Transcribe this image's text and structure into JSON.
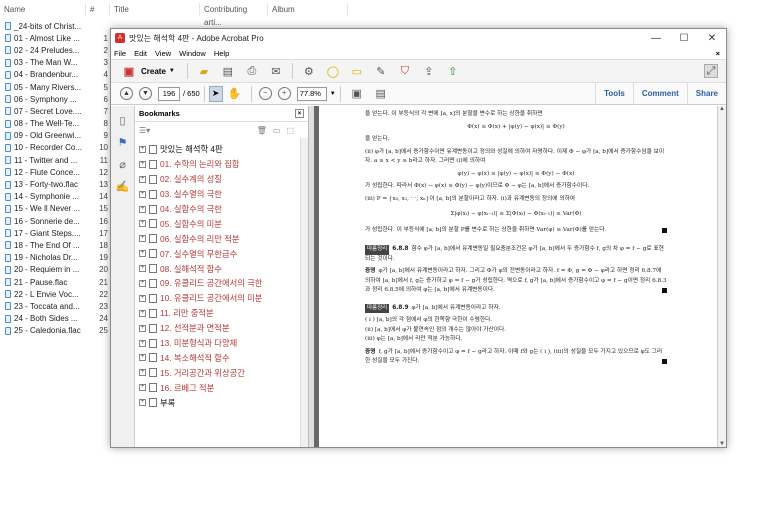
{
  "filelist": {
    "headers": {
      "name": "Name",
      "num": "#",
      "title": "Title",
      "artist": "Contributing arti...",
      "album": "Album"
    },
    "files": [
      {
        "name": "_24-bits of Christ...",
        "num": ""
      },
      {
        "name": "01 - Almost Like ...",
        "num": "1"
      },
      {
        "name": "02 - 24 Preludes...",
        "num": "2"
      },
      {
        "name": "03 - The Man W...",
        "num": "3"
      },
      {
        "name": "04 - Brandenbur...",
        "num": "4"
      },
      {
        "name": "05 - Many Rivers...",
        "num": "5"
      },
      {
        "name": "06 - Symphony ...",
        "num": "6"
      },
      {
        "name": "07 - Secret Love....",
        "num": "7"
      },
      {
        "name": "08 - The Well-Te...",
        "num": "8"
      },
      {
        "name": "09 - Old Greenwi...",
        "num": "9"
      },
      {
        "name": "10 - Recorder Co...",
        "num": "10"
      },
      {
        "name": "11 - Twitter and ...",
        "num": "11"
      },
      {
        "name": "12 - Flute Conce...",
        "num": "12"
      },
      {
        "name": "13 - Forty-two.flac",
        "num": "13"
      },
      {
        "name": "14 - Symphonie ...",
        "num": "14"
      },
      {
        "name": "15 - We ll Never ...",
        "num": "15"
      },
      {
        "name": "16 - Sonnerie de...",
        "num": "16"
      },
      {
        "name": "17 - Giant Steps....",
        "num": "17"
      },
      {
        "name": "18 - The End Of ...",
        "num": "18"
      },
      {
        "name": "19 - Nicholas Dr...",
        "num": "19"
      },
      {
        "name": "20 - Requiem in ...",
        "num": "20"
      },
      {
        "name": "21 - Pause.flac",
        "num": "21"
      },
      {
        "name": "22 - L Envie Voc...",
        "num": "22"
      },
      {
        "name": "23 - Toccata and...",
        "num": "23"
      },
      {
        "name": "24 - Both Sides ...",
        "num": "24"
      },
      {
        "name": "25 - Caledonia.flac",
        "num": "25"
      }
    ]
  },
  "window": {
    "title": "맛있는 해석학 4판 - Adobe Acrobat Pro",
    "controls": [
      "—",
      "☐",
      "✕"
    ],
    "menu": [
      "File",
      "Edit",
      "View",
      "Window",
      "Help"
    ],
    "menu_close": "×",
    "create_label": "Create",
    "page_current": "196",
    "page_total": "/ 650",
    "zoom": "77.8%",
    "right_links": [
      "Tools",
      "Comment",
      "Share"
    ]
  },
  "bookmarks": {
    "title": "Bookmarks",
    "items": [
      {
        "label": "맛있는 해석학 4판",
        "color": "black"
      },
      {
        "label": "01. 수학의 논리와 집합",
        "color": "red"
      },
      {
        "label": "02. 실수계의 성질",
        "color": "red"
      },
      {
        "label": "03. 실수열의 극한",
        "color": "red"
      },
      {
        "label": "04. 실함수의 극한",
        "color": "red"
      },
      {
        "label": "05. 실함수의 미분",
        "color": "red"
      },
      {
        "label": "06. 실함수의 리만 적분",
        "color": "red"
      },
      {
        "label": "07. 실수열의 무한급수",
        "color": "red"
      },
      {
        "label": "08. 실해석적 함수",
        "color": "red"
      },
      {
        "label": "09. 유클리드 공간에서의 극한",
        "color": "red"
      },
      {
        "label": "10. 유클리드 공간에서의 미분",
        "color": "red"
      },
      {
        "label": "11. 리만 중적분",
        "color": "red"
      },
      {
        "label": "12. 선적분과 면적분",
        "color": "red"
      },
      {
        "label": "13. 미분형식과 다양체",
        "color": "red"
      },
      {
        "label": "14. 복소해석적 함수",
        "color": "red"
      },
      {
        "label": "15. 거리공간과 위상공간",
        "color": "red"
      },
      {
        "label": "16. 르베그 적분",
        "color": "red"
      },
      {
        "label": "부록",
        "color": "black"
      }
    ]
  },
  "doc": {
    "lines": [
      "을 얻는다. 이 부등식의 각 변에 [a, x]의 분할을 변수로 하는 상한을 취하면",
      "Φ(x) ≤ Φ(x) + |φ(y) − φ(x)| ≤ Φ(y)",
      "을 얻는다.",
      "(ii) φ가 [a, b]에서 증가함수이면 유계변동이고 정의와 성질에 의하여 자명하다. 이제 Φ − φ가 [a, b]에서 증가함수임을 보이자. a ≤ x < y ≤ b라고 하자. 그러면 (i)에 의하여",
      "φ(y) − φ(x) ≤ |φ(y) − φ(x)| ≤ Φ(y) − Φ(x)",
      "가 성립한다. 따라서 Φ(x) − φ(x) ≤ Φ(y) − φ(y)이므로 Φ − φ는 [a, b]에서 증가함수이다.",
      "(iii) P = {x₀, x₁, ⋯, xₙ}이 [a, b]의 분할이라고 하자. (i)과 유계변동의 정의에 의하여",
      "Σ|φ(xᵢ) − φ(xᵢ₋₁)| ≤ Σ|Φ(xᵢ) − Φ(xᵢ₋₁)| ≤ Var(Φ)",
      "가 성립한다. 이 부등식에 [a, b]의 분할 P를 변수로 하는 상한을 취하면 Var(φ) ≤ Var(Φ)를 얻는다."
    ],
    "theorem1_tag": "따름정리",
    "theorem1_num": "6.8.8",
    "theorem1_text": "함수 φ가 [a, b]에서 유계변동일 필요충분조건은 φ가 [a, b]에서 두 증가함수 f, g의 차 φ = f − g로 표현되는 것이다.",
    "proof_label": "증명",
    "proof1_text": "φ가 [a, b]에서 유계변동이라고 하자. 그리고 Φ가 φ의 전변동이라고 하자. f = Φ, g = Φ − φ라고 하면 정리 6.8.7에 의하여 [a, b]에서 f, g는 증가하고 φ = f − g가 성립한다. 역으로 f, g가 [a, b]에서 증가함수이고 φ = f − g이면 정리 6.8.3과 정리 6.8.5에 의하여 φ는 [a, b]에서 유계변동이다.",
    "theorem2_tag": "따름정리",
    "theorem2_num": "6.8.9",
    "theorem2_text": "φ가 [a, b]에서 유계변동이라고 하자.",
    "theorem2_items": [
      "( i ) [a, b]의 각 점에서 φ의 한쪽향 극한이 수렴한다.",
      "(ii) [a, b]에서 φ가 불연속인 점의 개수는 많아야 가산이다.",
      "(iii) φ는 [a, b]에서 리만 적분 가능하다."
    ],
    "proof2_text": "f, g가 [a, b]에서 증가함수이고 φ = f − g라고 하자. 이때 f와 g는 ( i ), (iii)의 성질을 모두 가지고 있으므로 φ도 그러한 성질을 모두 가진다."
  }
}
